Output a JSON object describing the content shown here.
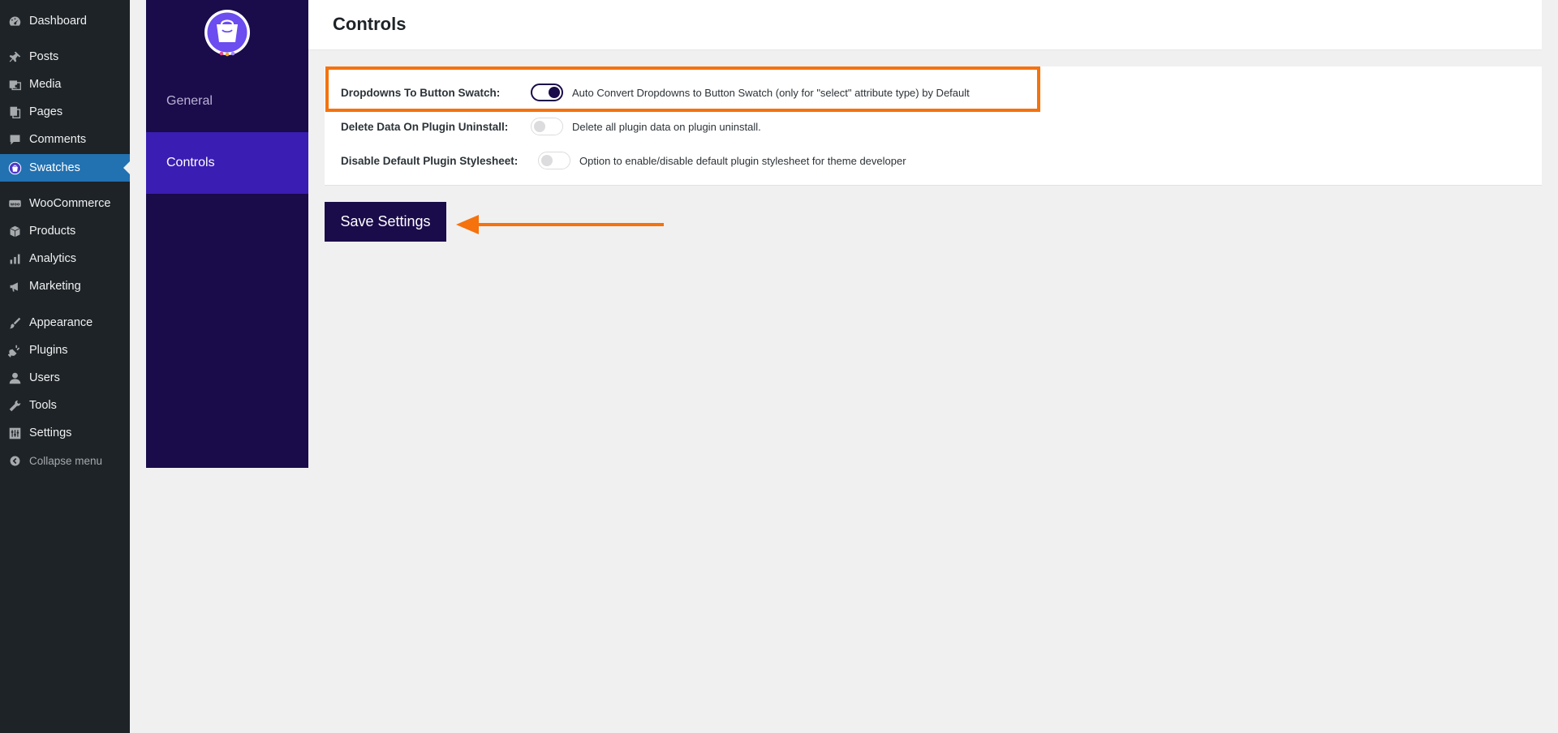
{
  "wp_menu": {
    "items": [
      {
        "label": "Dashboard",
        "icon": "dashboard-icon"
      },
      {
        "label": "Posts",
        "icon": "pin-icon"
      },
      {
        "label": "Media",
        "icon": "media-icon"
      },
      {
        "label": "Pages",
        "icon": "pages-icon"
      },
      {
        "label": "Comments",
        "icon": "comment-icon"
      },
      {
        "label": "Swatches",
        "icon": "swatches-icon",
        "active": true
      },
      {
        "label": "WooCommerce",
        "icon": "woo-icon"
      },
      {
        "label": "Products",
        "icon": "box-icon"
      },
      {
        "label": "Analytics",
        "icon": "bar-chart-icon"
      },
      {
        "label": "Marketing",
        "icon": "megaphone-icon"
      },
      {
        "label": "Appearance",
        "icon": "brush-icon"
      },
      {
        "label": "Plugins",
        "icon": "plug-icon"
      },
      {
        "label": "Users",
        "icon": "user-icon"
      },
      {
        "label": "Tools",
        "icon": "wrench-icon"
      },
      {
        "label": "Settings",
        "icon": "settings-icon"
      }
    ],
    "collapse_label": "Collapse menu"
  },
  "plugin_nav": {
    "general_label": "General",
    "controls_label": "Controls"
  },
  "page": {
    "title": "Controls"
  },
  "settings": [
    {
      "label": "Dropdowns To Button Swatch:",
      "enabled": true,
      "description": "Auto Convert Dropdowns to Button Swatch (only for \"select\" attribute type) by Default"
    },
    {
      "label": "Delete Data On Plugin Uninstall:",
      "enabled": false,
      "description": "Delete all plugin data on plugin uninstall."
    },
    {
      "label": "Disable Default Plugin Stylesheet:",
      "enabled": false,
      "description": "Option to enable/disable default plugin stylesheet for theme developer"
    }
  ],
  "save_button_label": "Save Settings",
  "colors": {
    "wp_sidebar": "#1d2327",
    "wp_active": "#2271b1",
    "plugin_nav": "#1a0b4a",
    "plugin_active": "#3a1db3",
    "highlight": "#f5720c"
  }
}
